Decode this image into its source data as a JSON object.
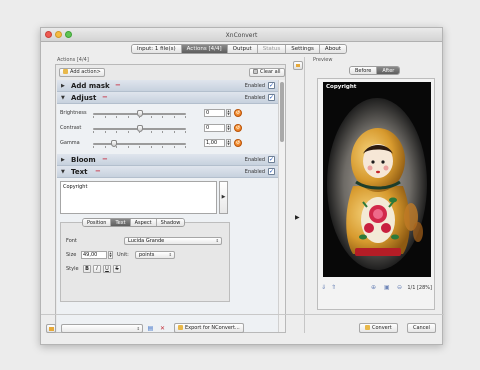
{
  "window": {
    "title": "XnConvert"
  },
  "tabs": [
    {
      "label": "Input: 1 file(s)",
      "state": "normal"
    },
    {
      "label": "Actions [4/4]",
      "state": "active"
    },
    {
      "label": "Output",
      "state": "normal"
    },
    {
      "label": "Status",
      "state": "disabled"
    },
    {
      "label": "Settings",
      "state": "normal"
    },
    {
      "label": "About",
      "state": "normal"
    }
  ],
  "actions_panel": {
    "label": "Actions [4/4]",
    "add_action_label": "Add action>",
    "clear_all_label": "Clear all",
    "enabled_label": "Enabled",
    "actions": [
      {
        "name": "Add mask",
        "expanded": false,
        "enabled": true
      },
      {
        "name": "Adjust",
        "expanded": true,
        "enabled": true
      },
      {
        "name": "Bloom",
        "expanded": false,
        "enabled": true
      },
      {
        "name": "Text",
        "expanded": true,
        "enabled": true
      }
    ],
    "adjust": {
      "sliders": [
        {
          "label": "Brightness",
          "value": "0",
          "level": 0.5
        },
        {
          "label": "Contrast",
          "value": "0",
          "level": 0.5
        },
        {
          "label": "Gamma",
          "value": "1,00",
          "level": 0.23
        }
      ]
    },
    "text": {
      "content": "Copyright",
      "subtabs": [
        "Position",
        "Text",
        "Aspect",
        "Shadow"
      ],
      "active_subtab": "Text",
      "font_label": "Font",
      "font_value": "Lucida Grande",
      "size_label": "Size",
      "size_value": "49,00",
      "unit_label": "Unit:",
      "unit_value": "points",
      "style_label": "Style",
      "style_buttons": [
        "B",
        "I",
        "U",
        "S"
      ]
    }
  },
  "preview": {
    "label": "Preview",
    "toggle": [
      "Before",
      "After"
    ],
    "active_toggle": "After",
    "overlay_text": "Copyright",
    "counter": "1/1 [28%]"
  },
  "bottom": {
    "export_label": "Export for NConvert...",
    "convert_label": "Convert",
    "cancel_label": "Cancel"
  },
  "colors": {
    "accent_tab": "#6f6f6f",
    "remove_action": "#c8263a",
    "reset_orange": "#e56a0e",
    "checkbox_blue": "#1a4fb0"
  }
}
